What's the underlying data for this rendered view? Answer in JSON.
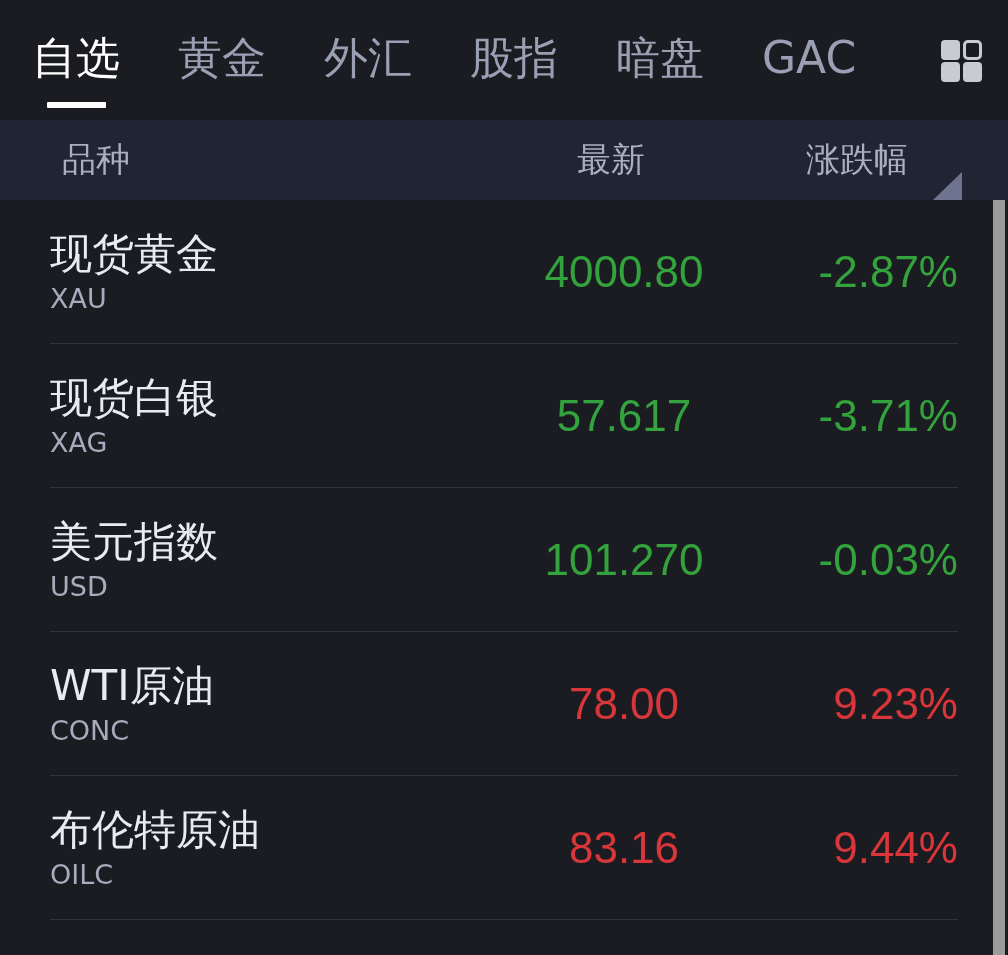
{
  "tabs": [
    {
      "label": "自选",
      "selected": true
    },
    {
      "label": "黄金",
      "selected": false
    },
    {
      "label": "外汇",
      "selected": false
    },
    {
      "label": "股指",
      "selected": false
    },
    {
      "label": "暗盘",
      "selected": false
    },
    {
      "label": "GAC",
      "selected": false
    }
  ],
  "columns": [
    "品种",
    "最新",
    "涨跌幅"
  ],
  "rows": [
    {
      "name": "现货黄金",
      "code": "XAU",
      "price": "4000.80",
      "change": "-2.87%",
      "color": "#33a33d"
    },
    {
      "name": "现货白银",
      "code": "XAG",
      "price": "57.617",
      "change": "-3.71%",
      "color": "#33a33d"
    },
    {
      "name": "美元指数",
      "code": "USD",
      "price": "101.270",
      "change": "-0.03%",
      "color": "#33a33d"
    },
    {
      "name": "WTI原油",
      "code": "CONC",
      "price": "78.00",
      "change": "9.23%",
      "color": "#d8363a"
    },
    {
      "name": "布伦特原油",
      "code": "OILC",
      "price": "83.16",
      "change": "9.44%",
      "color": "#d8363a"
    }
  ]
}
